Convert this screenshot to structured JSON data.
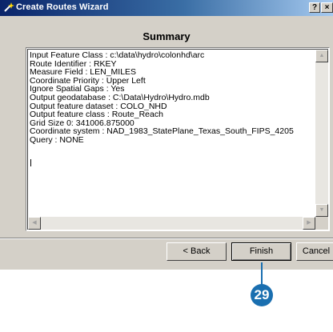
{
  "window": {
    "title": "Create Routes Wizard",
    "help_label": "?",
    "close_label": "×"
  },
  "page": {
    "heading": "Summary"
  },
  "summary_lines": [
    "Input Feature Class : c:\\data\\hydro\\colonhd\\arc",
    "Route Identifier : RKEY",
    "Measure Field : LEN_MILES",
    "Coordinate Priority : Upper Left",
    "Ignore Spatial Gaps : Yes",
    "Output geodatabase : C:\\Data\\Hydro\\Hydro.mdb",
    "Output feature dataset : COLO_NHD",
    "Output feature class : Route_Reach",
    "Grid Size 0: 341006.875000",
    "Coordinate system : NAD_1983_StatePlane_Texas_South_FIPS_4205",
    "Query : NONE"
  ],
  "buttons": {
    "back": "< Back",
    "finish": "Finish",
    "cancel": "Cancel"
  },
  "callout": {
    "number": "29"
  },
  "colors": {
    "titlebar_start": "#0a246a",
    "titlebar_end": "#a6caf0",
    "dialog_face": "#d4d0c8",
    "callout": "#1a6fb0"
  },
  "icons": {
    "title": "wizard-wand-icon",
    "scroll_up": "arrow-up-icon",
    "scroll_down": "arrow-down-icon",
    "scroll_left": "arrow-left-icon",
    "scroll_right": "arrow-right-icon"
  }
}
